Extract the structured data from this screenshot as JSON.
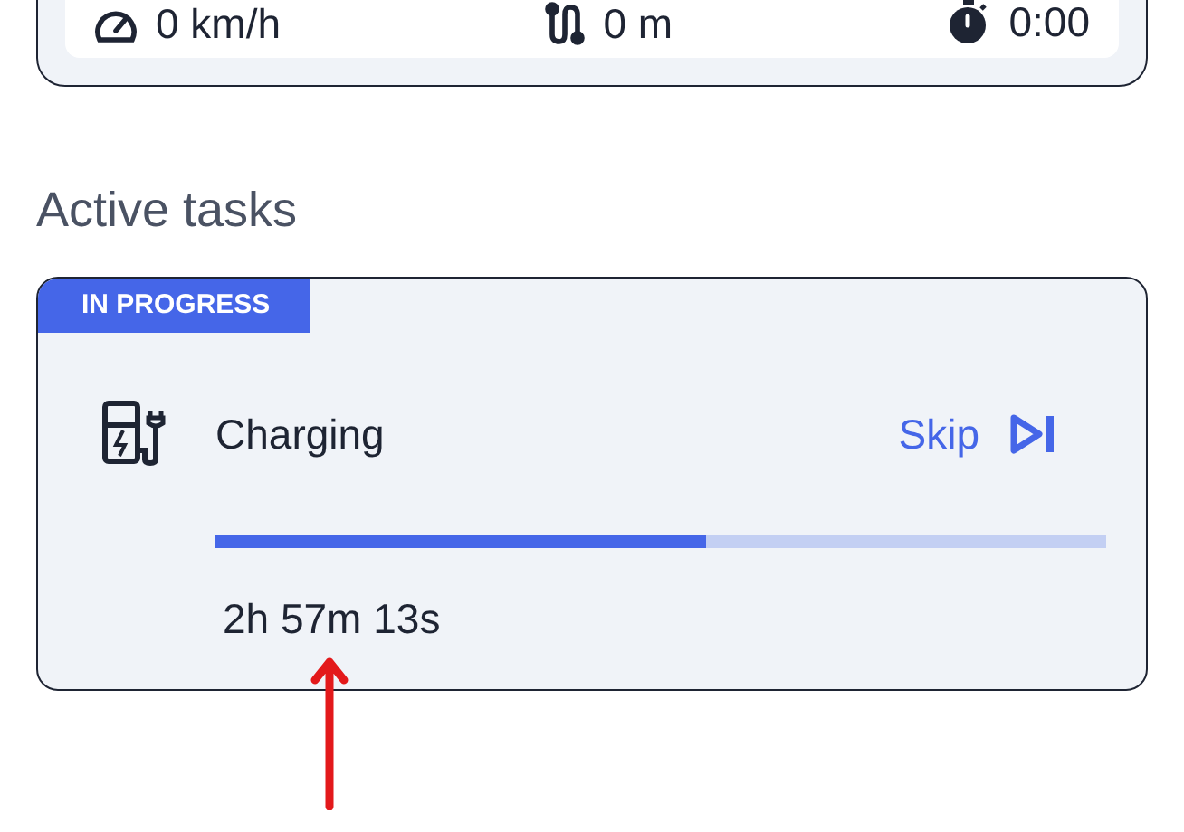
{
  "stats": [
    {
      "kind": "speed",
      "value": "0 km/h"
    },
    {
      "kind": "distance",
      "value": "0 m"
    },
    {
      "kind": "time",
      "value": "0:00"
    }
  ],
  "section_title": "Active tasks",
  "task": {
    "badge": "IN PROGRESS",
    "title": "Charging",
    "action": "Skip",
    "level": 0.55,
    "remaining": "2h 57m 13s"
  }
}
